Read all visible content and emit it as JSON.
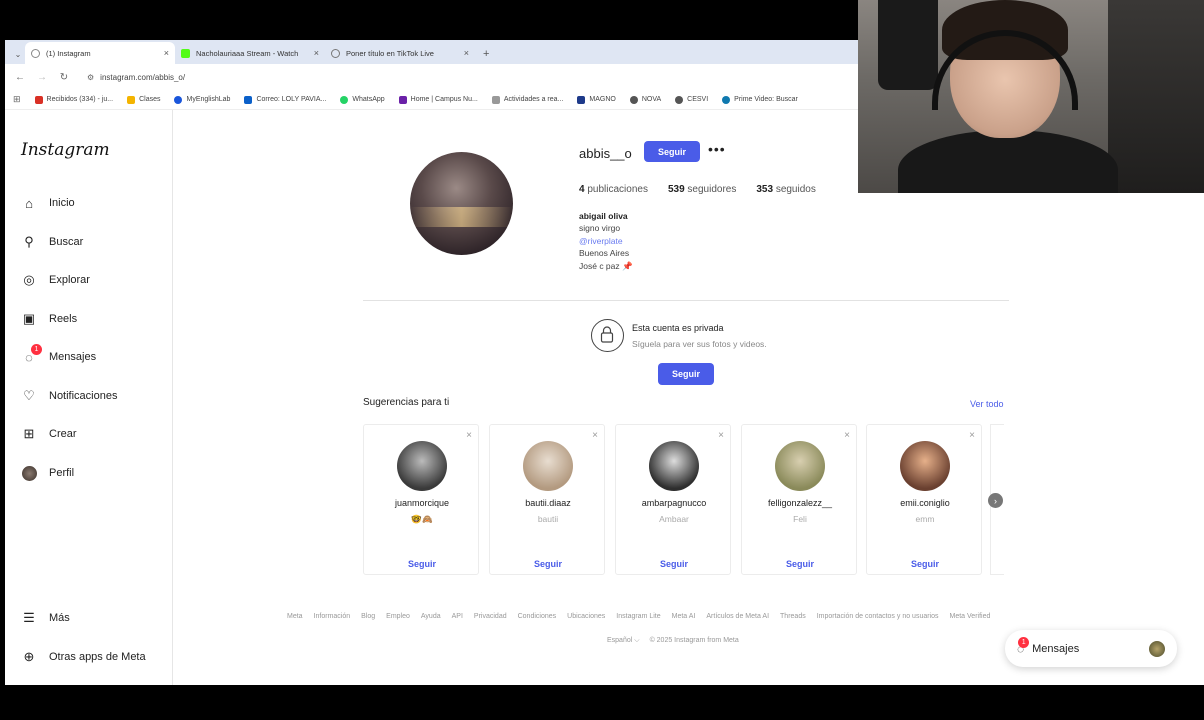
{
  "browser": {
    "tabs": [
      {
        "title": "(1) Instagram",
        "active": true,
        "favicon_color": "#8a8a8a"
      },
      {
        "title": "Nacholauriaaa Stream - Watch",
        "active": false,
        "favicon_color": "#53fc18"
      },
      {
        "title": "Poner título en TikTok Live",
        "active": false,
        "favicon_color": "#777777"
      }
    ],
    "url": "instagram.com/abbis_o/",
    "bookmarks": [
      {
        "label": "Recibidos (334) - ju...",
        "color": "#d93025"
      },
      {
        "label": "Clases",
        "color": "#f4b400"
      },
      {
        "label": "MyEnglishLab",
        "color": "#1a56db"
      },
      {
        "label": "Correo: LOLY PAVIA...",
        "color": "#0b60c9"
      },
      {
        "label": "WhatsApp",
        "color": "#25d366"
      },
      {
        "label": "Home | Campus Nu...",
        "color": "#6b21a8"
      },
      {
        "label": "Actividades a rea...",
        "color": "#999999"
      },
      {
        "label": "MAGNO",
        "color": "#1e3a8a"
      },
      {
        "label": "NOVA",
        "color": "#555555"
      },
      {
        "label": "CESVI",
        "color": "#555555"
      },
      {
        "label": "Prime Video: Buscar",
        "color": "#0f79af"
      }
    ]
  },
  "sidebar": {
    "logo": "Instagram",
    "items": [
      {
        "label": "Inicio",
        "icon": "home-icon",
        "glyph": "⌂"
      },
      {
        "label": "Buscar",
        "icon": "search-icon",
        "glyph": "⚲"
      },
      {
        "label": "Explorar",
        "icon": "compass-icon",
        "glyph": "◎"
      },
      {
        "label": "Reels",
        "icon": "reels-icon",
        "glyph": "▣"
      },
      {
        "label": "Mensajes",
        "icon": "messenger-icon",
        "glyph": "◌",
        "badge": "1"
      },
      {
        "label": "Notificaciones",
        "icon": "heart-icon",
        "glyph": "♡"
      },
      {
        "label": "Crear",
        "icon": "plus-square-icon",
        "glyph": "⊞"
      },
      {
        "label": "Perfil",
        "icon": "profile-avatar-icon",
        "glyph": "●"
      }
    ],
    "more": {
      "label": "Más",
      "icon": "menu-icon",
      "glyph": "☰"
    },
    "meta_apps": {
      "label": "Otras apps de Meta",
      "icon": "apps-icon",
      "glyph": "⊕"
    }
  },
  "profile": {
    "username": "abbis__o",
    "follow_label": "Seguir",
    "more_label": "•••",
    "stats": [
      {
        "value": "4",
        "label": "publicaciones"
      },
      {
        "value": "539",
        "label": "seguidores"
      },
      {
        "value": "353",
        "label": "seguidos"
      }
    ],
    "bio": {
      "name": "abigail oliva",
      "line1": "signo virgo",
      "link": "@riverplate",
      "line2": "Buenos Aires",
      "line3": "José c paz 📌"
    }
  },
  "private": {
    "title": "Esta cuenta es privada",
    "subtitle": "Síguela para ver sus fotos y videos.",
    "follow_label": "Seguir"
  },
  "suggestions": {
    "title": "Sugerencias para ti",
    "see_all": "Ver todo",
    "cards": [
      {
        "user": "juanmorcique",
        "sub": "🤓🙈",
        "follow": "Seguir",
        "color": "#3a3a3a"
      },
      {
        "user": "bautii.diaaz",
        "sub": "bautii",
        "follow": "Seguir",
        "color": "#b39a80"
      },
      {
        "user": "ambarpagnucco",
        "sub": "Ambaar",
        "follow": "Seguir",
        "color": "#2e2e2e"
      },
      {
        "user": "felligonzalezz__",
        "sub": "Feli",
        "follow": "Seguir",
        "color": "#8a8a5a"
      },
      {
        "user": "emii.coniglio",
        "sub": "emm",
        "follow": "Seguir",
        "color": "#c27a4a"
      }
    ]
  },
  "footer": {
    "links": [
      "Meta",
      "Información",
      "Blog",
      "Empleo",
      "Ayuda",
      "API",
      "Privacidad",
      "Condiciones",
      "Ubicaciones",
      "Instagram Lite",
      "Meta AI",
      "Artículos de Meta AI",
      "Threads",
      "Importación de contactos y no usuarios",
      "Meta Verified"
    ],
    "language": "Español ⌵",
    "copyright": "© 2025 Instagram from Meta"
  },
  "messages_bar": {
    "label": "Mensajes",
    "badge": "1"
  }
}
